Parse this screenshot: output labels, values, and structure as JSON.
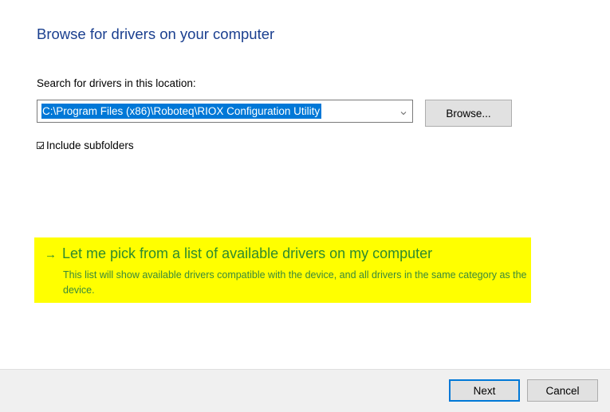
{
  "dialog": {
    "heading": "Browse for drivers on your computer"
  },
  "search": {
    "label": "Search for drivers in this location:",
    "path_value": "C:\\Program Files (x86)\\Roboteq\\RIOX Configuration Utility",
    "browse_label": "Browse..."
  },
  "subfolders": {
    "checked": true,
    "label": "Include subfolders"
  },
  "pick_option": {
    "arrow": "→",
    "title": "Let me pick from a list of available drivers on my computer",
    "description": "This list will show available drivers compatible with the device, and all drivers in the same category as the device."
  },
  "footer": {
    "next_label": "Next",
    "cancel_label": "Cancel"
  },
  "colors": {
    "heading": "#1a3f8f",
    "selection": "#0078d7",
    "highlight": "#ffff00",
    "link_green": "#2e8b2e",
    "default_button_border": "#0078d7"
  },
  "icons": {
    "dropdown": "chevron-down-icon",
    "checkbox": "checkmark-icon",
    "link_arrow": "arrow-right-icon"
  }
}
